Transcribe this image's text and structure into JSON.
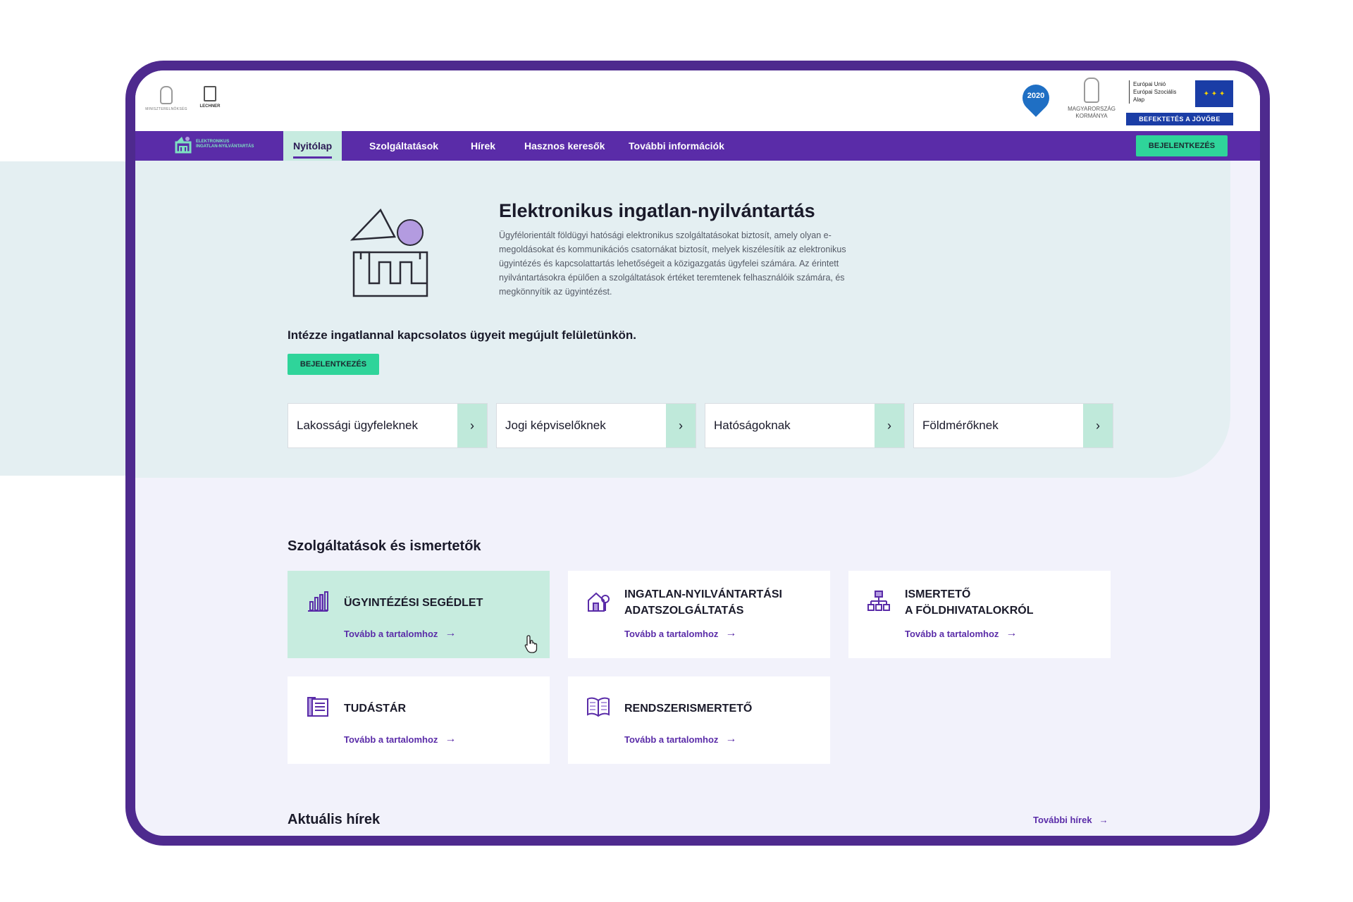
{
  "brand": {
    "ministry_text": "MINISZTERELNÖKSÉG",
    "lechner_text": "LECHNER",
    "sz2020_year": "2020",
    "gov_text": "MAGYARORSZÁG KORMÁNYA",
    "eu_lines": [
      "Európai Unió",
      "Európai Szociális",
      "Alap"
    ],
    "eu_band": "BEFEKTETÉS A JÖVŐBE"
  },
  "site": {
    "logo_name_line1": "ELEKTRONIKUS",
    "logo_name_line2": "INGATLAN-NYILVÁNTARTÁS"
  },
  "nav": {
    "items": [
      "Nyitólap",
      "Szolgáltatások",
      "Hírek",
      "Hasznos keresők",
      "További információk"
    ],
    "active_index": 0,
    "login_label": "BEJELENTKEZÉS"
  },
  "hero": {
    "title": "Elektronikus ingatlan-nyilvántartás",
    "description": "Ügyfélorientált földügyi hatósági elektronikus szolgáltatásokat biztosít, amely olyan e-megoldásokat és kommunikációs csatornákat biztosít, melyek kiszélesítik az elektronikus ügyintézés és kapcsolattartás lehetőségeit a közigazgatás ügyfelei számára. Az érintett nyilvántartásokra épülően a szolgáltatások értéket teremtenek felhasználóik számára, és megkönnyítik az ügyintézést.",
    "tagline": "Intézze ingatlannal kapcsolatos ügyeit megújult felületünkön.",
    "login_label": "BEJELENTKEZÉS",
    "audiences": [
      "Lakossági ügyfeleknek",
      "Jogi képviselőknek",
      "Hatóságoknak",
      "Földmérőknek"
    ],
    "arrow_glyph": "›"
  },
  "services": {
    "title": "Szolgáltatások és ismertetők",
    "more_label": "Tovább a tartalomhoz",
    "cards": [
      {
        "title_lines": [
          "Ügyintézési segédlet"
        ],
        "icon": "bar-chart-icon",
        "highlight": true
      },
      {
        "title_lines": [
          "Ingatlan-nyilvántartási",
          "adatszolgáltatás"
        ],
        "icon": "house-tree-icon",
        "highlight": false
      },
      {
        "title_lines": [
          "Ismertető",
          "a földhivatalokról"
        ],
        "icon": "org-chart-icon",
        "highlight": false
      },
      {
        "title_lines": [
          "Tudástár"
        ],
        "icon": "document-icon",
        "highlight": false
      },
      {
        "title_lines": [
          "Rendszerismertető"
        ],
        "icon": "open-book-icon",
        "highlight": false
      }
    ]
  },
  "news": {
    "title": "Aktuális hírek",
    "more_label": "További hírek"
  },
  "colors": {
    "primary": "#5a2ca8",
    "accent_green": "#2fd49a",
    "mint": "#c7ecdf",
    "hero_bg": "#e4eff2",
    "page_bg": "#f2f2fb",
    "eu_blue": "#1a3da6"
  }
}
